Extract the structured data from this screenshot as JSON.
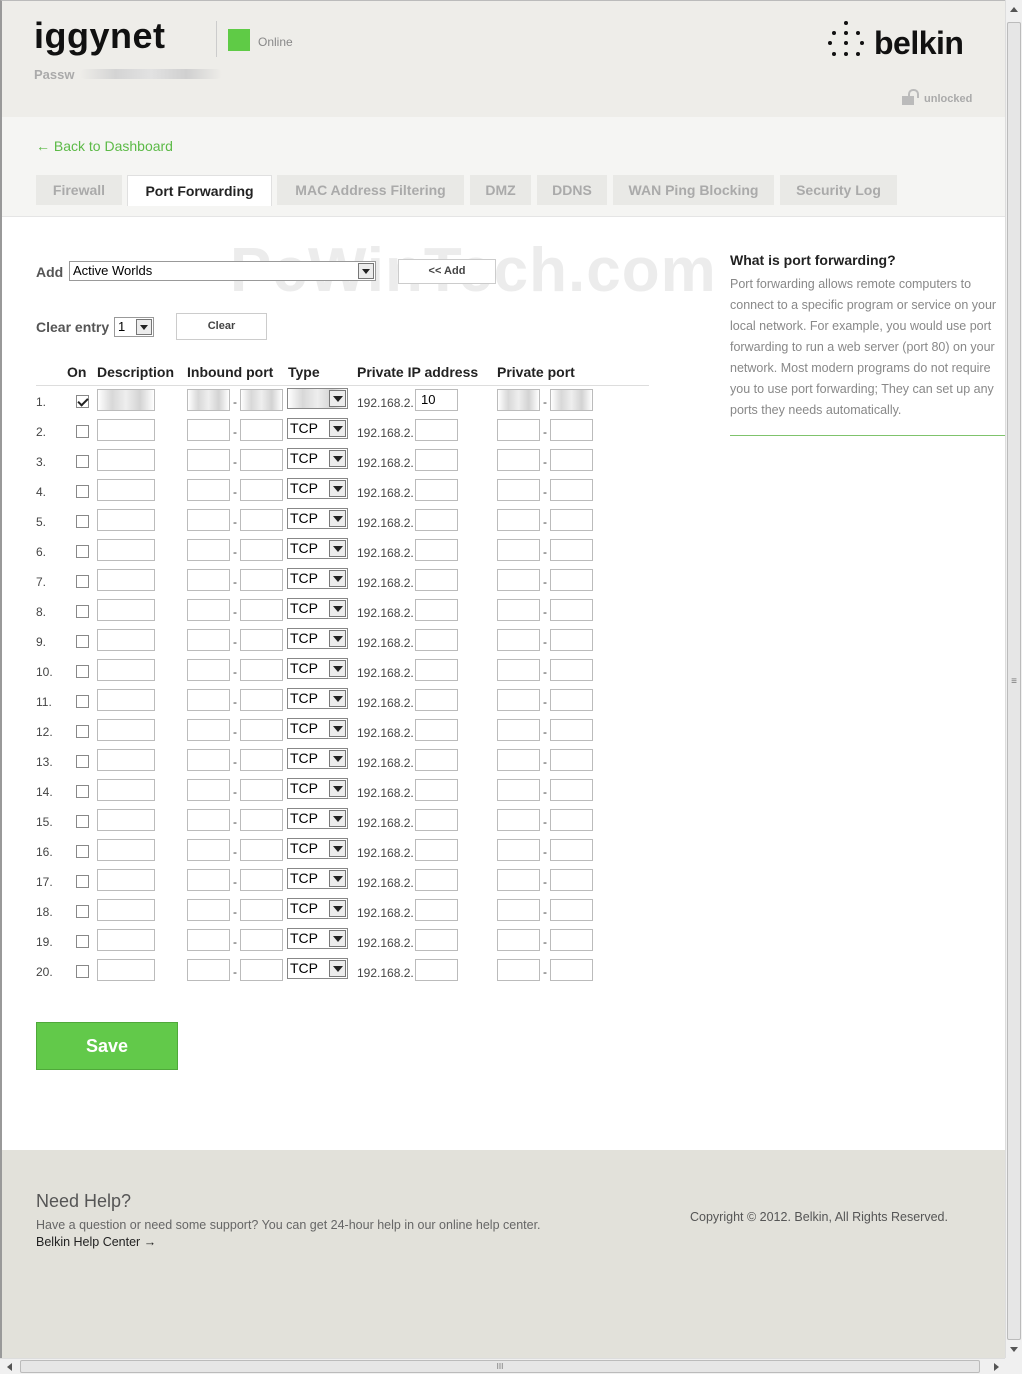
{
  "header": {
    "network_name": "iggynet",
    "password_label": "Passw",
    "status": "Online",
    "status_color": "#5fcb46",
    "brand": "belkin",
    "lock_status": "unlocked"
  },
  "nav": {
    "back_link": "← Back to Dashboard",
    "tabs": [
      {
        "label": "Firewall",
        "active": false
      },
      {
        "label": "Port Forwarding",
        "active": true
      },
      {
        "label": "MAC Address Filtering",
        "active": false
      },
      {
        "label": "DMZ",
        "active": false
      },
      {
        "label": "DDNS",
        "active": false
      },
      {
        "label": "WAN Ping Blocking",
        "active": false
      },
      {
        "label": "Security Log",
        "active": false
      }
    ]
  },
  "form": {
    "add_label": "Add",
    "add_select_value": "Active Worlds",
    "add_button": "<< Add",
    "clear_label": "Clear entry",
    "clear_select_value": "1",
    "clear_button": "Clear",
    "columns": {
      "on": "On",
      "description": "Description",
      "inbound_port": "Inbound port",
      "type": "Type",
      "private_ip": "Private IP address",
      "private_port": "Private port"
    },
    "ip_prefix": "192.168.2.",
    "rows": [
      {
        "num": "1.",
        "on": true,
        "type": "",
        "ip_last": "10"
      },
      {
        "num": "2.",
        "on": false,
        "type": "TCP",
        "ip_last": ""
      },
      {
        "num": "3.",
        "on": false,
        "type": "TCP",
        "ip_last": ""
      },
      {
        "num": "4.",
        "on": false,
        "type": "TCP",
        "ip_last": ""
      },
      {
        "num": "5.",
        "on": false,
        "type": "TCP",
        "ip_last": ""
      },
      {
        "num": "6.",
        "on": false,
        "type": "TCP",
        "ip_last": ""
      },
      {
        "num": "7.",
        "on": false,
        "type": "TCP",
        "ip_last": ""
      },
      {
        "num": "8.",
        "on": false,
        "type": "TCP",
        "ip_last": ""
      },
      {
        "num": "9.",
        "on": false,
        "type": "TCP",
        "ip_last": ""
      },
      {
        "num": "10.",
        "on": false,
        "type": "TCP",
        "ip_last": ""
      },
      {
        "num": "11.",
        "on": false,
        "type": "TCP",
        "ip_last": ""
      },
      {
        "num": "12.",
        "on": false,
        "type": "TCP",
        "ip_last": ""
      },
      {
        "num": "13.",
        "on": false,
        "type": "TCP",
        "ip_last": ""
      },
      {
        "num": "14.",
        "on": false,
        "type": "TCP",
        "ip_last": ""
      },
      {
        "num": "15.",
        "on": false,
        "type": "TCP",
        "ip_last": ""
      },
      {
        "num": "16.",
        "on": false,
        "type": "TCP",
        "ip_last": ""
      },
      {
        "num": "17.",
        "on": false,
        "type": "TCP",
        "ip_last": ""
      },
      {
        "num": "18.",
        "on": false,
        "type": "TCP",
        "ip_last": ""
      },
      {
        "num": "19.",
        "on": false,
        "type": "TCP",
        "ip_last": ""
      },
      {
        "num": "20.",
        "on": false,
        "type": "TCP",
        "ip_last": ""
      }
    ],
    "save_button": "Save",
    "save_color": "#62c94a"
  },
  "sidebar": {
    "title": "What is port forwarding?",
    "text": "Port forwarding allows remote computers to connect to a specific program or service on your local network. For example, you would use port forwarding to run a web server (port 80) on your network. Most modern programs do not require you to use port forwarding; They can set up any ports they needs automatically."
  },
  "watermark": "PcWinTech.com",
  "footer": {
    "help_title": "Need Help?",
    "help_text": "Have a question or need some support? You can get 24-hour help in our online help center.",
    "help_link": "Belkin Help Center →",
    "copyright": "Copyright © 2012. Belkin, All Rights Reserved."
  },
  "scrollbar": {
    "thumb_grip": "≡",
    "thumb_grip_h": "III"
  }
}
